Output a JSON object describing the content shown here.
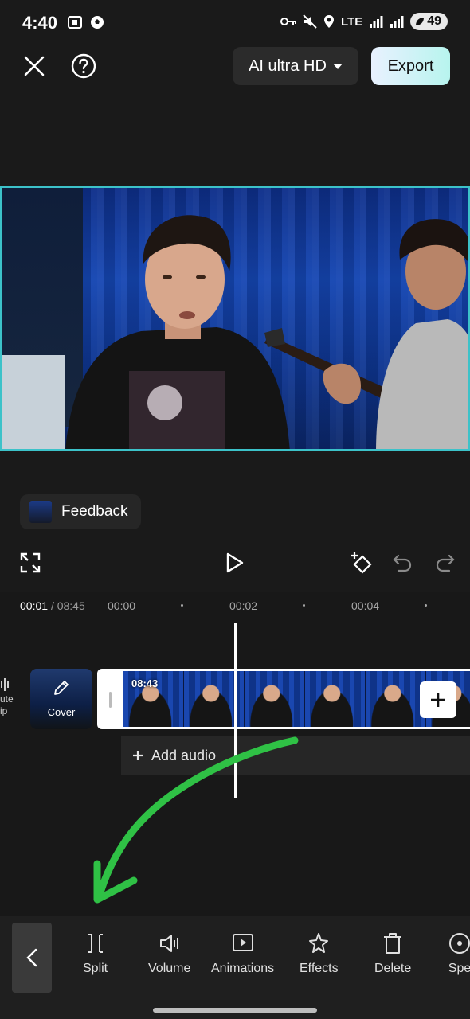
{
  "status": {
    "time": "4:40",
    "network": "LTE",
    "battery": "49"
  },
  "header": {
    "quality_label": "AI ultra HD",
    "export_label": "Export"
  },
  "feedback": {
    "label": "Feedback"
  },
  "timeline": {
    "current_time": "00:01",
    "total_time": "/ 08:45",
    "ticks": [
      "00:00",
      "00:02",
      "00:04"
    ],
    "mute_label_line1": "ute",
    "mute_label_line2": "ip",
    "cover_label": "Cover",
    "clip_duration": "08:43",
    "add_audio_label": "Add audio"
  },
  "toolbar": {
    "items": [
      {
        "label": "Split",
        "icon": "split-icon"
      },
      {
        "label": "Volume",
        "icon": "volume-icon"
      },
      {
        "label": "Animations",
        "icon": "animations-icon"
      },
      {
        "label": "Effects",
        "icon": "effects-icon"
      },
      {
        "label": "Delete",
        "icon": "delete-icon"
      },
      {
        "label": "Spe",
        "icon": "speed-icon"
      }
    ]
  },
  "colors": {
    "accent_border": "#3cc2c9",
    "annotation_arrow": "#2fc145"
  }
}
